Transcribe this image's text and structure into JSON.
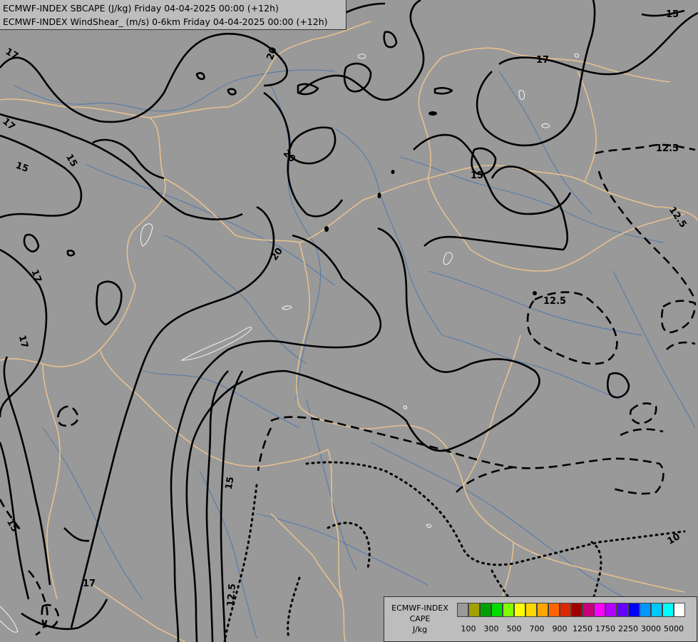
{
  "header": {
    "line1": "ECMWF-INDEX SBCAPE (J/kg) Friday 04-04-2025 00:00 (+12h)",
    "line2": "ECMWF-INDEX WindShear_ (m/s) 0-6km Friday 04-04-2025 00:00 (+12h)"
  },
  "legend": {
    "title_lines": [
      "ECMWF-INDEX",
      "CAPE",
      "J/kg"
    ],
    "colors": [
      "#999999",
      "#a0a000",
      "#00a000",
      "#00dc00",
      "#80ff00",
      "#ffff00",
      "#ffd700",
      "#ffa500",
      "#ff6400",
      "#dc2800",
      "#a00000",
      "#c80078",
      "#ff00ff",
      "#b400ff",
      "#6400ff",
      "#0000ff",
      "#0096ff",
      "#00c8ff",
      "#00ffff",
      "#ffffff"
    ],
    "tick_labels": [
      "100",
      "300",
      "500",
      "700",
      "900",
      "1250",
      "1750",
      "2250",
      "3000",
      "5000"
    ]
  },
  "contour_labels": [
    "20",
    "15",
    "17",
    "17",
    "15",
    "15",
    "17",
    "20",
    "20",
    "17",
    "15",
    "12.5",
    "12.5",
    "12.5",
    "15",
    "12.5",
    "17",
    "17",
    "15",
    "10"
  ]
}
